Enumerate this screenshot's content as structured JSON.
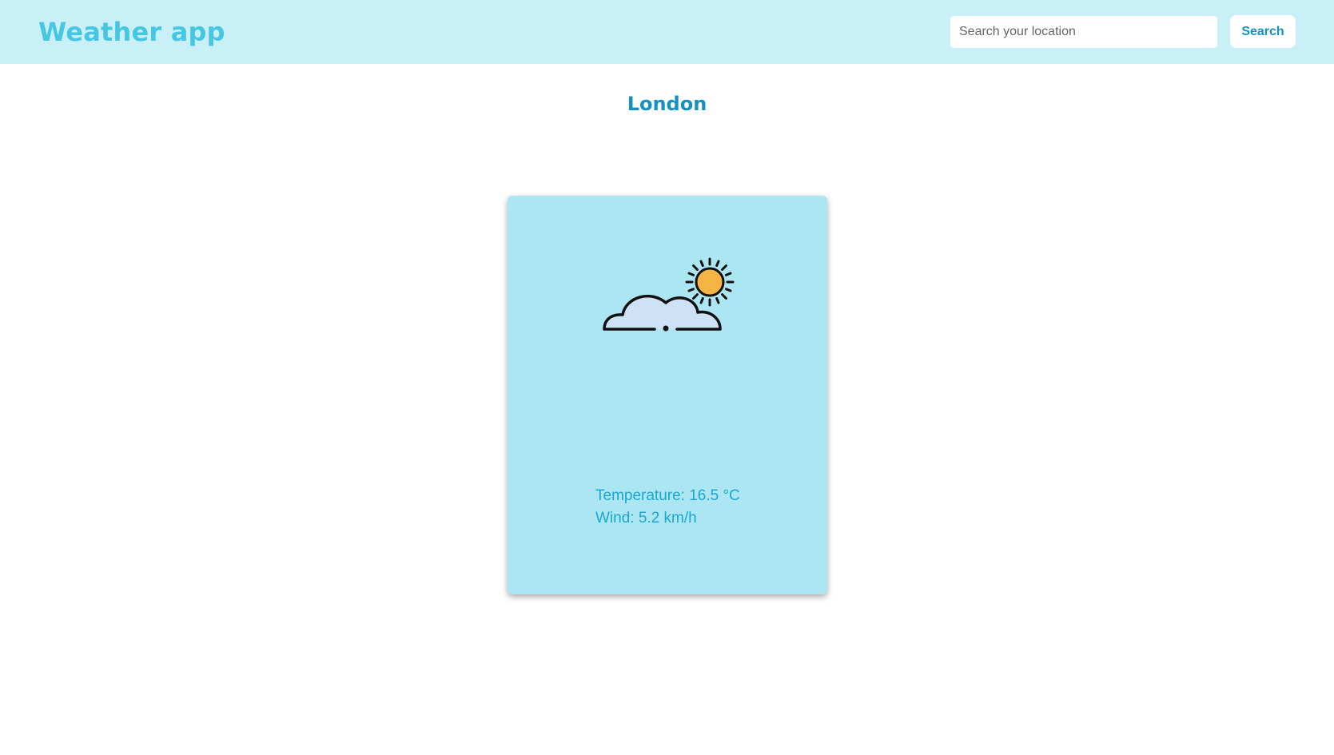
{
  "header": {
    "app_title": "Weather app",
    "search_placeholder": "Search your location",
    "search_value": "",
    "search_button_label": "Search"
  },
  "location": {
    "city": "London"
  },
  "weather": {
    "icon": "partly-cloudy-icon",
    "temperature_label": "Temperature: 16.5 °C",
    "wind_label": "Wind: 5.2 km/h"
  },
  "colors": {
    "header_bg": "#c9eff7",
    "title": "#45c6e2",
    "accent": "#1591c1",
    "card_bg": "#ade6f3",
    "stat_text": "#1aa6cf",
    "sun": "#f6b443",
    "cloud": "#cde3f5"
  }
}
